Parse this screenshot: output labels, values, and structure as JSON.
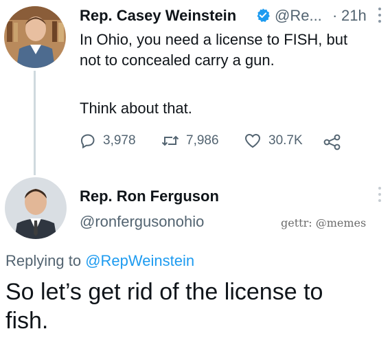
{
  "tweet": {
    "author_name": "Rep. Casey Weinstein",
    "handle": "@Re...",
    "separator": "·",
    "time": "21h",
    "text_lines": [
      "In Ohio, you need a license to FISH, but",
      "not to concealed carry a gun.",
      "Think about that."
    ],
    "reply_count": "3,978",
    "retweet_count": "7,986",
    "like_count": "30.7K",
    "icons": {
      "verified": "verified-badge-icon",
      "reply": "reply-icon",
      "retweet": "retweet-icon",
      "like": "heart-icon",
      "share": "share-icon",
      "more": "more-options-icon"
    }
  },
  "reply": {
    "author_name": "Rep. Ron Ferguson",
    "handle": "@ronfergusonohio",
    "watermark": "gettr: @memes",
    "replying_to_label": "Replying to",
    "replying_to_handle": "@RepWeinstein",
    "text_lines": [
      "So let’s get rid of the license to",
      "fish."
    ]
  },
  "colors": {
    "text": "#0f1419",
    "muted": "#536471",
    "link": "#1d9bf0",
    "verified": "#1d9bf0",
    "thread_line": "#cfd9de"
  }
}
